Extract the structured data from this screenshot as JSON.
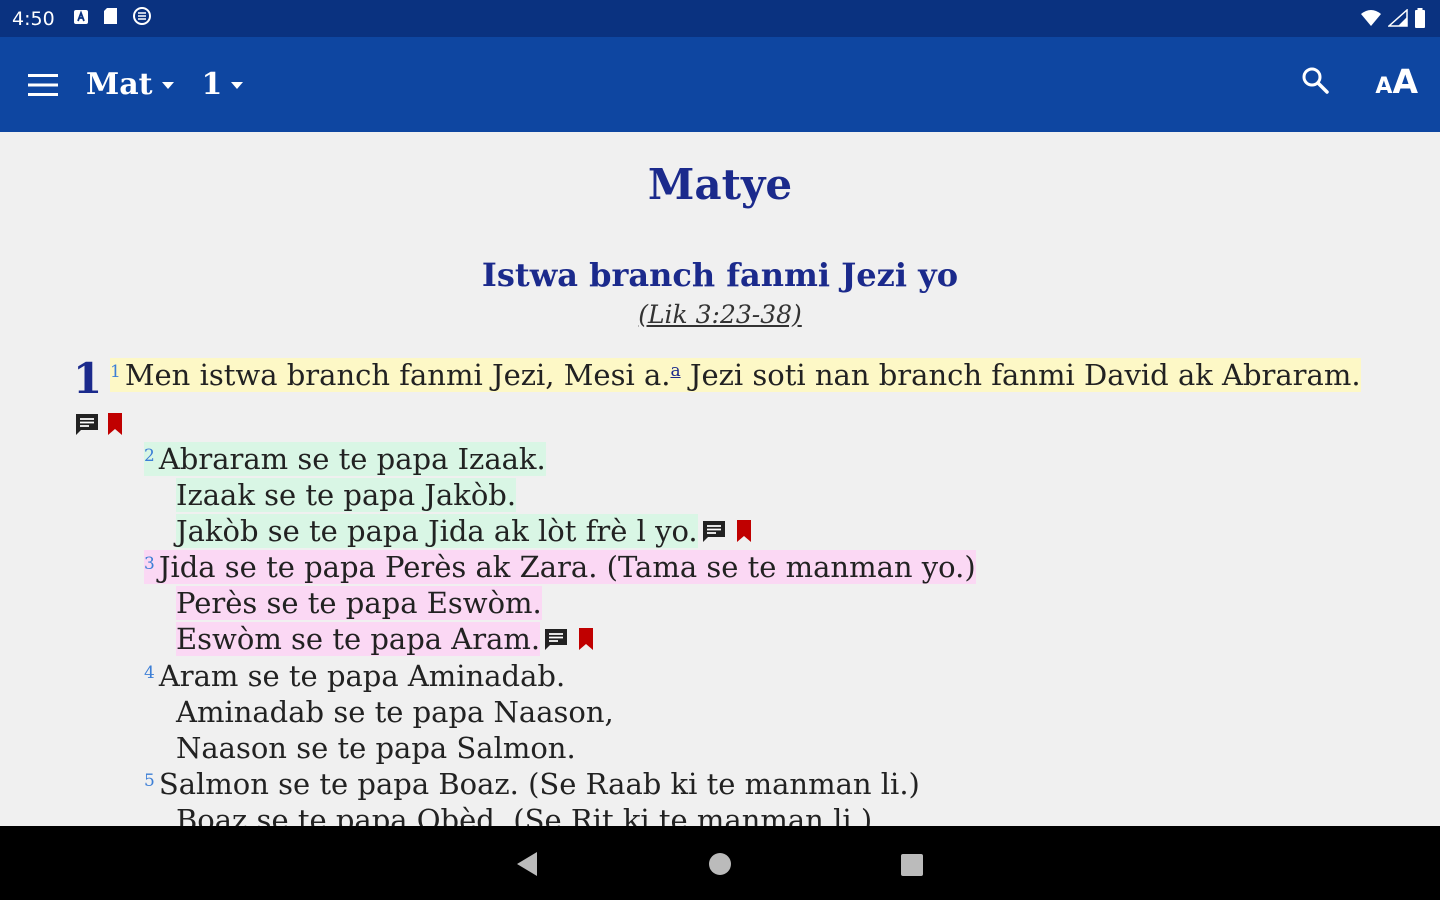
{
  "status_bar": {
    "time": "4:50",
    "left_icons": [
      "a-notification-icon",
      "sd-card-icon",
      "vpn-icon"
    ],
    "right_icons": [
      "wifi-icon",
      "signal-icon",
      "battery-icon"
    ]
  },
  "toolbar": {
    "book_label": "Mat",
    "chapter_label": "1",
    "font_small": "A",
    "font_big": "A"
  },
  "content": {
    "book_title": "Matye",
    "section_heading": "Istwa branch fanmi Jezi yo",
    "crossref": "(Lik 3:23-38)",
    "chapter_number": "1",
    "verse1": {
      "num": "1",
      "text_a": "Men istwa branch fanmi Jezi, Mesi a.",
      "footnote": "a",
      "text_b": " Jezi soti nan branch fanmi David ak Abraram."
    },
    "verse2": {
      "num": "2",
      "line1": "Abraram se te papa Izaak.",
      "line2": "Izaak se te papa Jakòb.",
      "line3": "Jakòb se te papa Jida ak lòt frè l yo."
    },
    "verse3": {
      "num": "3",
      "line1": "Jida se te papa Perès ak Zara. (Tama se te manman yo.)",
      "line2": "Perès se te papa Eswòm.",
      "line3": "Eswòm se te papa Aram."
    },
    "verse4": {
      "num": "4",
      "line1": "Aram se te papa Aminadab.",
      "line2": "Aminadab se te papa Naason,",
      "line3": "Naason se te papa Salmon."
    },
    "verse5": {
      "num": "5",
      "line1": "Salmon se te papa Boaz. (Se Raab ki te manman li.)",
      "line2": "Boaz se te papa Obèd. (Se Rit ki te manman li.)"
    }
  },
  "colors": {
    "status_bar": "#0a3280",
    "toolbar": "#0e46a1",
    "title": "#1b2a8c",
    "highlight_yellow": "#fdf8c6",
    "highlight_green": "#d9f6e5",
    "highlight_pink": "#fbd8f4",
    "bookmark_red": "#c00000"
  }
}
